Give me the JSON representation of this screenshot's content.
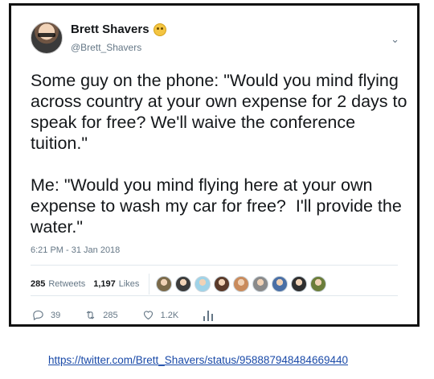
{
  "author": {
    "name": "Brett Shavers",
    "handle": "@Brett_Shavers"
  },
  "tweet": {
    "text": "Some guy on the phone: \"Would you mind flying across country at your own expense for 2 days to speak for free? We'll waive the conference tuition.\"\n\nMe: \"Would you mind flying here at your own expense to wash my car for free?  I'll provide the water.\"",
    "timestamp": "6:21 PM - 31 Jan 2018"
  },
  "stats": {
    "retweets_count": "285",
    "retweets_label": "Retweets",
    "likes_count": "1,197",
    "likes_label": "Likes"
  },
  "liker_colors": [
    "#7b6a4a",
    "#3b3b3b",
    "#9fd3e8",
    "#5a3a2a",
    "#c98b5c",
    "#8a8a8a",
    "#4a6fa5",
    "#2f2f2f",
    "#6b7d3a"
  ],
  "actions": {
    "reply_count": "39",
    "retweet_count": "285",
    "like_count": "1.2K"
  },
  "source_link": "https://twitter.com/Brett_Shavers/status/958887948484669440"
}
